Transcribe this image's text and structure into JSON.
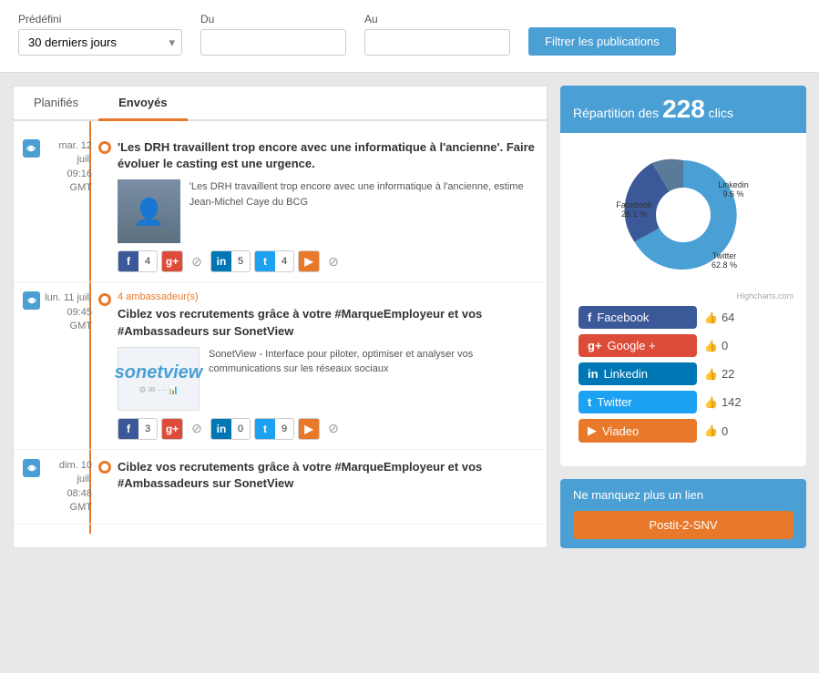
{
  "topbar": {
    "predefined_label": "Prédéfini",
    "predefined_placeholder": "30 derniers jours",
    "predefined_option": "30 derniers jours",
    "du_label": "Du",
    "au_label": "Au",
    "du_placeholder": "",
    "au_placeholder": "",
    "filter_button": "Filtrer les publications"
  },
  "tabs": {
    "tab1": "Planifiés",
    "tab2": "Envoyés"
  },
  "posts": [
    {
      "date": "mar. 12 juil.",
      "time": "09:16 GMT",
      "title": "'Les DRH travaillent trop encore avec une informatique à l'ancienne'. Faire évoluer le casting est une urgence.",
      "desc": "'Les DRH travaillent trop encore avec une informatique à l'ancienne, estime Jean-Michel Caye du BCG",
      "has_image": true,
      "fb_count": "4",
      "gp_count": "",
      "li_count": "5",
      "tw_count": "4",
      "ambassadeurs": ""
    },
    {
      "date": "lun. 11 juil.",
      "time": "09:45 GMT",
      "title": "Ciblez vos recrutements grâce à votre #MarqueEmployeur et vos #Ambassadeurs sur SonetView",
      "desc": "SonetView - Interface pour piloter, optimiser et analyser vos communications sur les réseaux sociaux",
      "has_image": false,
      "fb_count": "3",
      "gp_count": "",
      "li_count": "0",
      "tw_count": "9",
      "ambassadeurs": "4 ambassadeur(s)"
    },
    {
      "date": "dim. 10 juil.",
      "time": "08:48 GMT",
      "title": "Ciblez vos recrutements grâce à votre #MarqueEmployeur et vos #Ambassadeurs sur SonetView",
      "desc": "",
      "has_image": false,
      "fb_count": "",
      "gp_count": "",
      "li_count": "",
      "tw_count": "",
      "ambassadeurs": ""
    }
  ],
  "stats": {
    "header": "Répartition des",
    "total": "228",
    "unit": "clics",
    "chart_source": "Highcharts.com",
    "platforms": [
      {
        "name": "Facebook",
        "class": "fb",
        "count": "64",
        "pct": "28.1"
      },
      {
        "name": "Google +",
        "class": "gp",
        "count": "0",
        "pct": "0"
      },
      {
        "name": "Linkedin",
        "class": "li",
        "count": "22",
        "pct": "9.6"
      },
      {
        "name": "Twitter",
        "class": "tw",
        "count": "142",
        "pct": "62.8"
      },
      {
        "name": "Viadeo",
        "class": "vd",
        "count": "0",
        "pct": "0"
      }
    ],
    "pie_labels": {
      "facebook": "Facebook\n28.1 %",
      "linkedin": "Linkedin\n9.6 %",
      "twitter": "Twitter\n62.8 %"
    }
  },
  "promo": {
    "title": "Ne manquez plus un lien",
    "button": "Postit-2-SNV"
  }
}
